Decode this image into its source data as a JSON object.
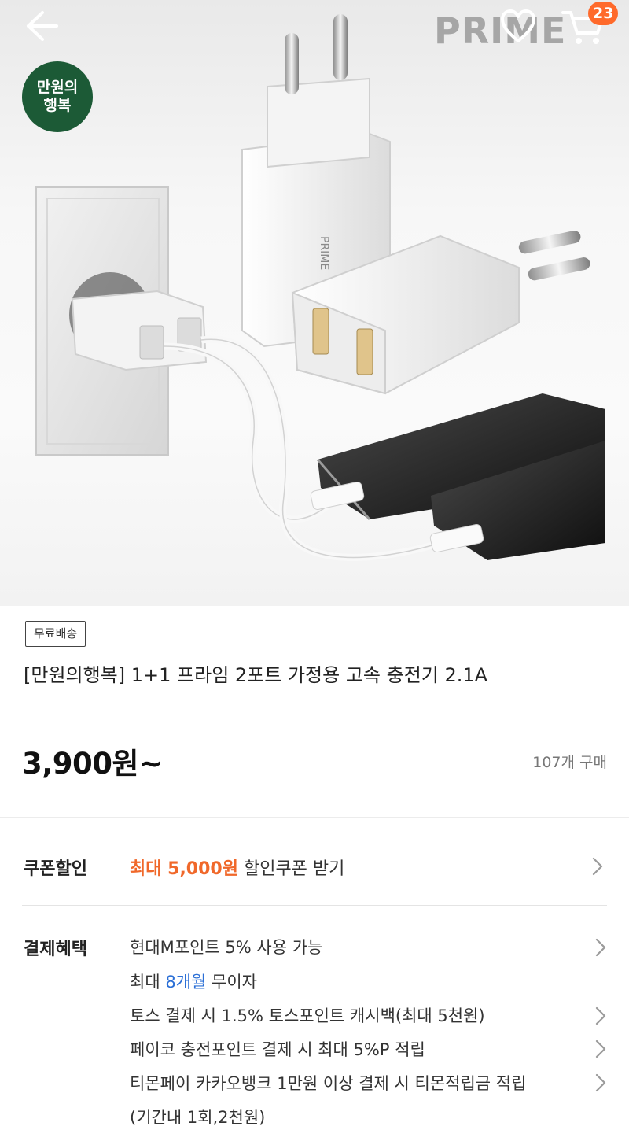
{
  "header": {
    "brand_logo": "PRIME",
    "cart_count": "23"
  },
  "hero": {
    "store_badge_line1": "만원의",
    "store_badge_line2": "행복",
    "product_label": "PRIME"
  },
  "product": {
    "ship_tag": "무료배송",
    "title": "[만원의행복] 1+1 프라임 2포트 가정용 고속 충전기 2.1A",
    "price": "3,900원~",
    "purchase_count": "107개 구매"
  },
  "coupon": {
    "label": "쿠폰할인",
    "highlight": "최대 5,000원",
    "rest": " 할인쿠폰 받기"
  },
  "benefits": {
    "label": "결제혜택",
    "line1": "현대M포인트 5% 사용 가능",
    "line2_pre": "최대 ",
    "line2_blue": "8개월",
    "line2_post": " 무이자",
    "line3": "토스 결제 시 1.5% 토스포인트 캐시백(최대 5천원)",
    "line4": "페이코 충전포인트 결제 시 최대 5%P 적립",
    "line5": "티몬페이 카카오뱅크 1만원 이상 결제 시 티몬적립금 적립",
    "line6": "(기간내 1회,2천원)"
  },
  "colors": {
    "accent_orange": "#f0682a",
    "badge_orange": "#ff6a2b",
    "link_blue": "#2b6fd6",
    "store_green": "#1c5a36"
  },
  "icons": [
    "back-arrow-icon",
    "cart-icon",
    "heart-icon",
    "chevron-right-icon"
  ]
}
